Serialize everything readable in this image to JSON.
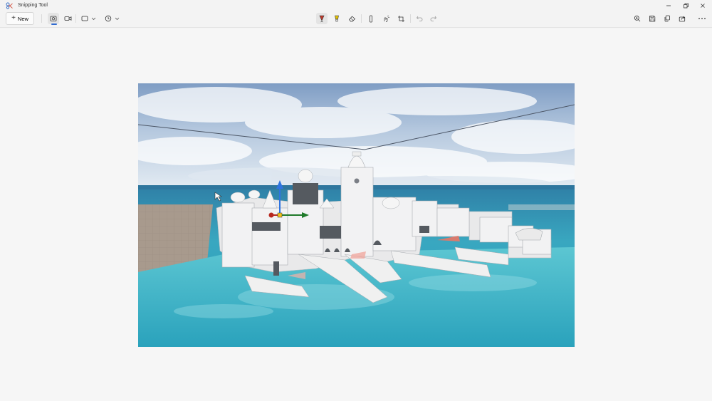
{
  "window": {
    "title": "Snipping Tool",
    "icons": {
      "app": "snipping-tool-icon",
      "minimize": "minimize-icon",
      "maximize": "restore-icon",
      "close": "close-icon"
    }
  },
  "toolbar": {
    "new_label": "New",
    "left_tools": [
      {
        "name": "screenshot-mode-icon",
        "selected": true
      },
      {
        "name": "video-mode-icon",
        "selected": false
      },
      {
        "name": "rectangle-mode-icon",
        "selected": false
      },
      {
        "name": "delay-timer-icon",
        "selected": false
      }
    ],
    "center_tools": [
      "ballpoint-pen-icon",
      "highlighter-icon",
      "eraser-icon",
      "ruler-icon",
      "touch-writing-icon",
      "crop-icon",
      "undo-icon",
      "redo-icon"
    ],
    "right_tools": [
      "zoom-icon",
      "save-icon",
      "copy-icon",
      "share-icon",
      "more-options-icon"
    ],
    "accent_color": "#2f6ad0",
    "pen_color": "#c0392b",
    "highlighter_color": "#e6c300"
  },
  "screenshot": {
    "subject": "3D editor viewport: white city on water"
  }
}
